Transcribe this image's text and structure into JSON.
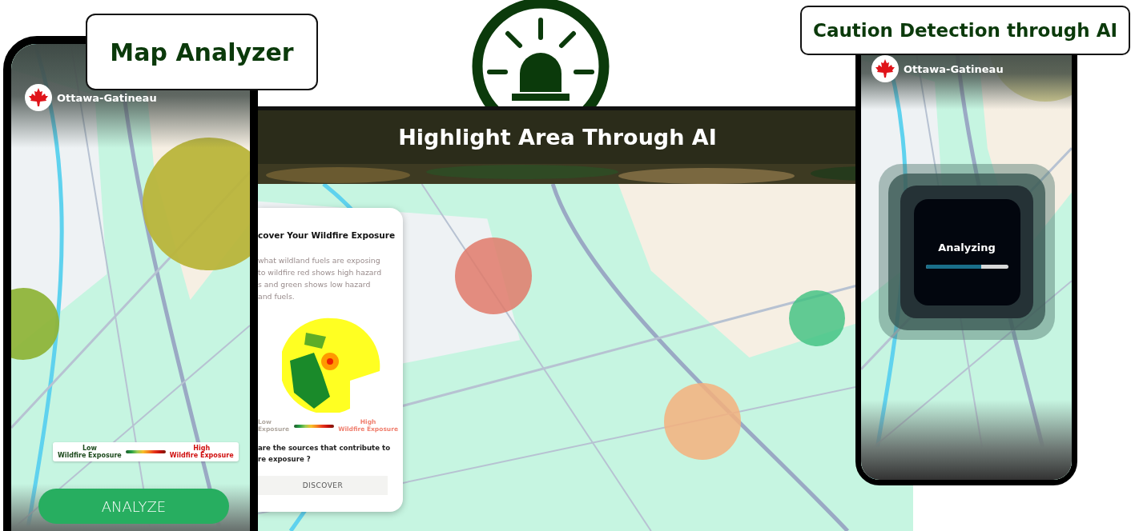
{
  "map_analyzer_card": {
    "title": "Map Analyzer"
  },
  "caution_card": {
    "title": "Caution Detection through AI"
  },
  "left_phone": {
    "location": "Ottawa-Gatineau",
    "legend": {
      "low": "Low",
      "low_caption": "Wildfire Exposure",
      "high": "High",
      "high_caption": "Wildfire Exposure"
    },
    "button": "ANALYZE"
  },
  "center_panel": {
    "banner": "Highlight Area Through AI",
    "card": {
      "title": "cover Your Wildfire Exposure",
      "description_lines": [
        "what wildland fuels are exposing",
        "to wildfire red shows high hazard",
        "s and green shows low hazard",
        "and fuels."
      ],
      "legend": {
        "low": "Low",
        "low_caption": "Exposure",
        "high": "High",
        "high_caption": "Wildfire Exposure"
      },
      "question_lines": [
        "are the sources that contribute to",
        "re exposure ?"
      ],
      "button": "DISCOVER"
    }
  },
  "right_phone": {
    "location": "Ottawa-Gatineau",
    "status": "Analyzing",
    "progress": {
      "level": 0.67
    }
  }
}
